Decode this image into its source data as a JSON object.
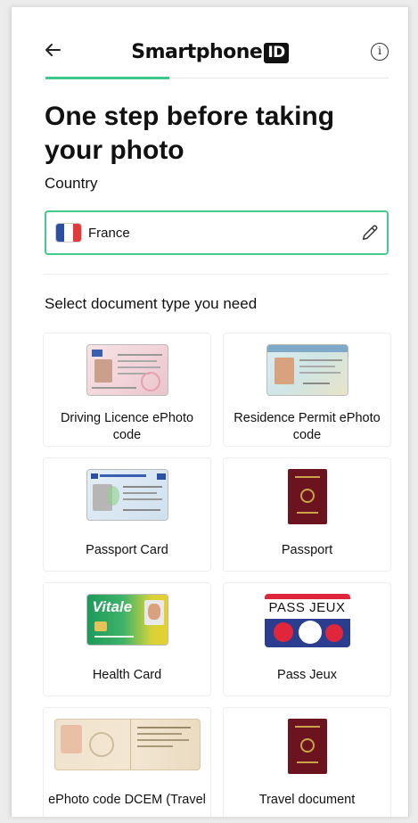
{
  "header": {
    "logo_text": "Smartphone",
    "logo_badge": "ID",
    "info_glyph": "i",
    "progress_fraction": 0.36
  },
  "page": {
    "title": "One step before taking your photo",
    "country_label": "Country",
    "country_value": "France",
    "document_prompt": "Select document type you need"
  },
  "colors": {
    "accent": "#45c98d",
    "flag": [
      "#2b4fa3",
      "#ffffff",
      "#e23a3a"
    ],
    "passport": "#6b1420"
  },
  "documents": [
    {
      "label": "Driving Licence ePhoto code",
      "icon": "driving-licence-card-icon"
    },
    {
      "label": "Residence Permit ePhoto code",
      "icon": "residence-permit-card-icon"
    },
    {
      "label": "Passport Card",
      "icon": "passport-card-icon"
    },
    {
      "label": "Passport",
      "icon": "passport-book-icon"
    },
    {
      "label": "Health Card",
      "icon": "vitale-health-card-icon"
    },
    {
      "label": "Pass Jeux",
      "icon": "pass-jeux-card-icon"
    },
    {
      "label": "ePhoto code DCEM (Travel",
      "icon": "dcem-document-icon"
    },
    {
      "label": "Travel document",
      "icon": "travel-document-book-icon"
    }
  ],
  "thumb_text": {
    "vitale": "Vitale",
    "pass_jeux": "PASS JEUX"
  }
}
